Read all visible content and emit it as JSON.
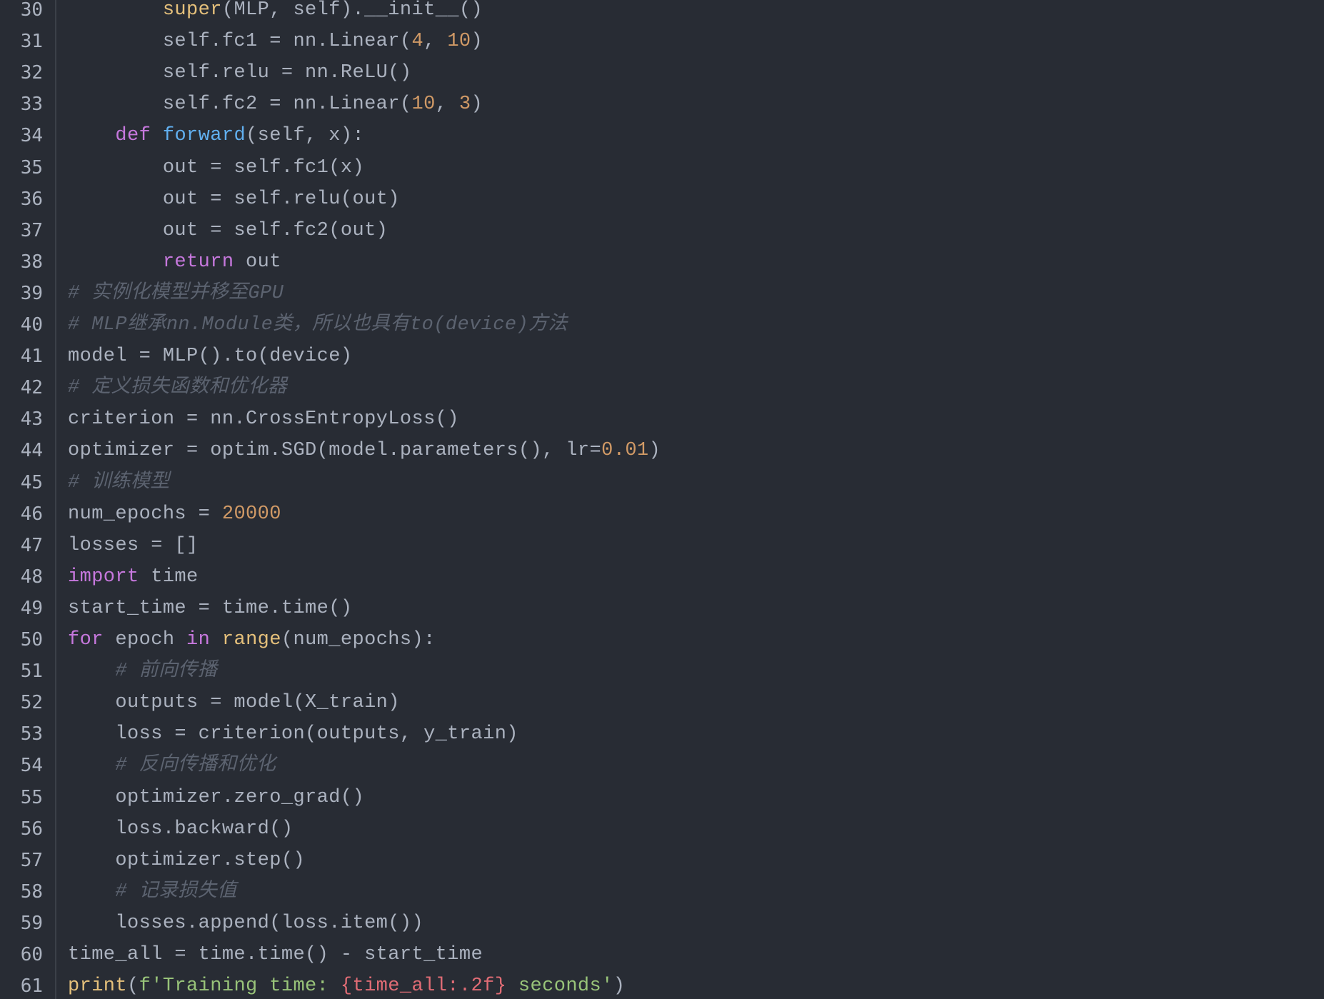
{
  "editor": {
    "language": "python",
    "theme": "one-dark",
    "colors": {
      "background": "#282c34",
      "text": "#abb2bf",
      "keyword": "#c678dd",
      "function": "#61afef",
      "builtin": "#e5c07b",
      "number": "#d19a66",
      "string": "#98c379",
      "interpolation": "#e06c75",
      "comment": "#5c6370"
    },
    "lines": [
      {
        "n": "30",
        "tokens": [
          {
            "t": "        "
          },
          {
            "t": "super",
            "c": "bi"
          },
          {
            "t": "(MLP, self).__init__()"
          }
        ]
      },
      {
        "n": "31",
        "tokens": [
          {
            "t": "        self.fc1 = nn.Linear("
          },
          {
            "t": "4",
            "c": "num"
          },
          {
            "t": ", "
          },
          {
            "t": "10",
            "c": "num"
          },
          {
            "t": ")"
          }
        ]
      },
      {
        "n": "32",
        "tokens": [
          {
            "t": "        self.relu = nn.ReLU()"
          }
        ]
      },
      {
        "n": "33",
        "tokens": [
          {
            "t": "        self.fc2 = nn.Linear("
          },
          {
            "t": "10",
            "c": "num"
          },
          {
            "t": ", "
          },
          {
            "t": "3",
            "c": "num"
          },
          {
            "t": ")"
          }
        ]
      },
      {
        "n": "34",
        "tokens": [
          {
            "t": "    "
          },
          {
            "t": "def",
            "c": "kw"
          },
          {
            "t": " "
          },
          {
            "t": "forward",
            "c": "fn"
          },
          {
            "t": "(self, x):"
          }
        ]
      },
      {
        "n": "35",
        "tokens": [
          {
            "t": "        out = self.fc1(x)"
          }
        ]
      },
      {
        "n": "36",
        "tokens": [
          {
            "t": "        out = self.relu(out)"
          }
        ]
      },
      {
        "n": "37",
        "tokens": [
          {
            "t": "        out = self.fc2(out)"
          }
        ]
      },
      {
        "n": "38",
        "tokens": [
          {
            "t": "        "
          },
          {
            "t": "return",
            "c": "kw"
          },
          {
            "t": " out"
          }
        ]
      },
      {
        "n": "39",
        "tokens": [
          {
            "t": "# 实例化模型并移至GPU",
            "c": "cm"
          }
        ]
      },
      {
        "n": "40",
        "tokens": [
          {
            "t": "# MLP继承nn.Module类，所以也具有to(device)方法",
            "c": "cm"
          }
        ]
      },
      {
        "n": "41",
        "tokens": [
          {
            "t": "model = MLP().to(device)"
          }
        ]
      },
      {
        "n": "42",
        "tokens": [
          {
            "t": "# 定义损失函数和优化器",
            "c": "cm"
          }
        ]
      },
      {
        "n": "43",
        "tokens": [
          {
            "t": "criterion = nn.CrossEntropyLoss()"
          }
        ]
      },
      {
        "n": "44",
        "tokens": [
          {
            "t": "optimizer = optim.SGD(model.parameters(), lr="
          },
          {
            "t": "0.01",
            "c": "num"
          },
          {
            "t": ")"
          }
        ]
      },
      {
        "n": "45",
        "tokens": [
          {
            "t": "# 训练模型",
            "c": "cm"
          }
        ]
      },
      {
        "n": "46",
        "tokens": [
          {
            "t": "num_epochs = "
          },
          {
            "t": "20000",
            "c": "num"
          }
        ]
      },
      {
        "n": "47",
        "tokens": [
          {
            "t": "losses = []"
          }
        ]
      },
      {
        "n": "48",
        "tokens": [
          {
            "t": "import",
            "c": "kw"
          },
          {
            "t": " time"
          }
        ]
      },
      {
        "n": "49",
        "tokens": [
          {
            "t": "start_time = time.time()"
          }
        ]
      },
      {
        "n": "50",
        "tokens": [
          {
            "t": "for",
            "c": "kw"
          },
          {
            "t": " epoch "
          },
          {
            "t": "in",
            "c": "kw"
          },
          {
            "t": " "
          },
          {
            "t": "range",
            "c": "bi"
          },
          {
            "t": "(num_epochs):"
          }
        ]
      },
      {
        "n": "51",
        "tokens": [
          {
            "t": "    "
          },
          {
            "t": "# 前向传播",
            "c": "cm"
          }
        ]
      },
      {
        "n": "52",
        "tokens": [
          {
            "t": "    outputs = model(X_train)"
          }
        ]
      },
      {
        "n": "53",
        "tokens": [
          {
            "t": "    loss = criterion(outputs, y_train)"
          }
        ]
      },
      {
        "n": "54",
        "tokens": [
          {
            "t": "    "
          },
          {
            "t": "# 反向传播和优化",
            "c": "cm"
          }
        ]
      },
      {
        "n": "55",
        "tokens": [
          {
            "t": "    optimizer.zero_grad()"
          }
        ]
      },
      {
        "n": "56",
        "tokens": [
          {
            "t": "    loss.backward()"
          }
        ]
      },
      {
        "n": "57",
        "tokens": [
          {
            "t": "    optimizer.step()"
          }
        ]
      },
      {
        "n": "58",
        "tokens": [
          {
            "t": "    "
          },
          {
            "t": "# 记录损失值",
            "c": "cm"
          }
        ]
      },
      {
        "n": "59",
        "tokens": [
          {
            "t": "    losses.append(loss.item())"
          }
        ]
      },
      {
        "n": "60",
        "tokens": [
          {
            "t": "time_all = time.time() - start_time"
          }
        ]
      },
      {
        "n": "61",
        "tokens": [
          {
            "t": "print",
            "c": "bi"
          },
          {
            "t": "("
          },
          {
            "t": "f'Training time: ",
            "c": "str"
          },
          {
            "t": "{time_all:.2f}",
            "c": "interp"
          },
          {
            "t": " seconds'",
            "c": "str"
          },
          {
            "t": ")"
          }
        ]
      }
    ]
  }
}
